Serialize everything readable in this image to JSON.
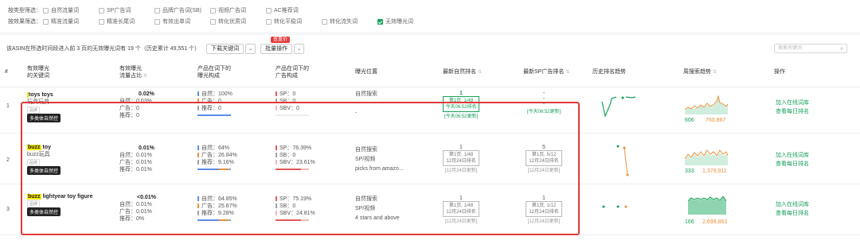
{
  "filters": {
    "type_row": {
      "label": "按类型筛选：",
      "options": [
        {
          "label": "自然流量词",
          "checked": false
        },
        {
          "label": "SP广告词",
          "checked": false
        },
        {
          "label": "品牌广告词(SB)",
          "checked": false
        },
        {
          "label": "视频广告词",
          "checked": false
        },
        {
          "label": "AC推荐词",
          "checked": false
        }
      ]
    },
    "effect_row": {
      "label": "按效果筛选：",
      "options": [
        {
          "label": "精准流量词",
          "checked": false
        },
        {
          "label": "精准长尾词",
          "checked": false
        },
        {
          "label": "有效出单词",
          "checked": false
        },
        {
          "label": "转化优质词",
          "checked": false
        },
        {
          "label": "转化平稳词",
          "checked": false
        },
        {
          "label": "转化流失词",
          "checked": false
        },
        {
          "label": "无效曝光词",
          "checked": true
        }
      ]
    }
  },
  "toolbar": {
    "summary": "该ASIN在所选时间段进入前 3 页的无效曝光词有 19 个（历史累计 49,551 个）",
    "download_label": "下载关键词",
    "batch_label": "批量操作",
    "new_badge": "查重价",
    "search_placeholder": "搜索关键词"
  },
  "columns": {
    "idx": "#",
    "kw": [
      "有效曝光",
      "的关键词"
    ],
    "share": [
      "有效曝光",
      "流量占比"
    ],
    "prod_exp": [
      "产品在词下的",
      "曝光构成"
    ],
    "prod_ad": [
      "产品在词下的",
      "广告构成"
    ],
    "position": "曝光位置",
    "organic_rank": "最新自然排名",
    "sp_rank": "最新SP广告排名",
    "history": "历史排名趋势",
    "weekly": "周搜索趋势",
    "action": "操作"
  },
  "rows": [
    {
      "idx": "1",
      "keyword_pre": "",
      "keyword_hl": "",
      "keyword_post": "toys toys",
      "keyword_cn": "玩具玩具",
      "tiny": "品牌",
      "tag": "多类体自然控",
      "share": {
        "total": "0.02%",
        "nat": "自然：0.03%",
        "ad": "广告：0",
        "rec": "推荐：0"
      },
      "exp": {
        "nat": "自然：100%",
        "ad": "广告：0",
        "rec": "推荐：0"
      },
      "ad": {
        "sp": "SP：0",
        "sb": "SB：0",
        "sbv": "SBV：0"
      },
      "pos": [
        "自然搜索",
        "-",
        "-"
      ],
      "org": {
        "top": "1",
        "box1": "第1页, 1/48",
        "box2": "今天06:52排名",
        "note": "[今天06:52更新]",
        "green": true
      },
      "sp": {
        "top": "-",
        "box1": "-",
        "box2": "-",
        "note": "[今天06:52更新]",
        "green": false
      },
      "weekly_low": "606",
      "weekly_high": "760,867",
      "actions": [
        "加入在线词库",
        "查看每日排名"
      ]
    },
    {
      "idx": "2",
      "keyword_pre": "",
      "keyword_hl": "buzz",
      "keyword_post": " toy",
      "keyword_cn": "buzz玩具",
      "tiny": "品牌",
      "tag": "多类体自然控",
      "share": {
        "total": "0.01%",
        "nat": "自然：0.01%",
        "ad": "广告：0.01%",
        "rec": "推荐：0.01%"
      },
      "exp": {
        "nat": "自然：64%",
        "ad": "广告：26.84%",
        "rec": "推荐：9.16%"
      },
      "ad": {
        "sp": "SP：76.39%",
        "sb": "SB：0",
        "sbv": "SBV：23.61%"
      },
      "pos": [
        "自然搜索",
        "SP/视频",
        "picks from amazo..."
      ],
      "org": {
        "top": "1",
        "box1": "第1页, 1/48",
        "box2": "12月24日排名",
        "note": "[12月24日更新]",
        "green": false
      },
      "sp": {
        "top": "5",
        "box1": "第1页, 5/12",
        "box2": "12月24日排名",
        "note": "[12月24日更新]",
        "green": false
      },
      "weekly_low": "333",
      "weekly_high": "1,379,911",
      "actions": [
        "加入在线词库",
        "查看每日排名"
      ]
    },
    {
      "idx": "3",
      "keyword_pre": "",
      "keyword_hl": "buzz",
      "keyword_post": " lightyear toy figure",
      "keyword_cn": "",
      "tiny": "品牌",
      "tag": "多类体自然控",
      "share": {
        "total": "<0.01%",
        "nat": "自然：0.01%",
        "ad": "广告：0.01%",
        "rec": "推荐：0%"
      },
      "exp": {
        "nat": "自然：64.85%",
        "ad": "广告：25.87%",
        "rec": "推荐：9.28%"
      },
      "ad": {
        "sp": "SP：75.19%",
        "sb": "SB：0",
        "sbv": "SBV：24.81%"
      },
      "pos": [
        "自然搜索",
        "SP/视频",
        "4 stars and above"
      ],
      "org": {
        "top": "1",
        "box1": "第1页, 1/48",
        "box2": "12月24日排名",
        "note": "[12月24日更新]",
        "green": false
      },
      "sp": {
        "top": "1",
        "box1": "第1页, 1/12",
        "box2": "12月24日排名",
        "note": "[12月24日更新]",
        "green": false
      },
      "weekly_low": "166",
      "weekly_high": "2,699,863",
      "actions": [
        "加入在线词库",
        "查看每日排名"
      ]
    }
  ],
  "colors": {
    "green": "#1aa15c",
    "orange": "#e8903a",
    "highlight_border": "#e03a3a",
    "nat_bar": "#5b8def",
    "ad_bar": "#e8903a",
    "rec_bar": "#9aa5b1"
  }
}
